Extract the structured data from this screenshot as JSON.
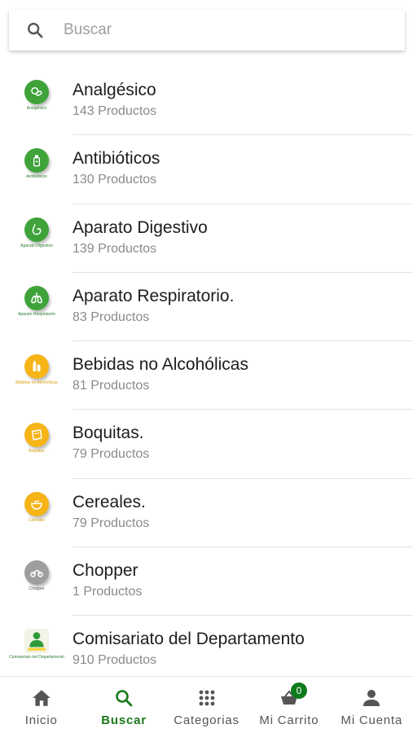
{
  "search": {
    "placeholder": "Buscar"
  },
  "categories": [
    {
      "name": "Analgésico",
      "count": "143 Productos",
      "icon": "pills-icon",
      "thumb_text": "Analgésico",
      "color": "#3fa33a"
    },
    {
      "name": "Antibióticos",
      "count": "130 Productos",
      "icon": "bottle-icon",
      "thumb_text": "Antibióticos",
      "color": "#3fa33a"
    },
    {
      "name": "Aparato Digestivo",
      "count": "139 Productos",
      "icon": "stomach-icon",
      "thumb_text": "Aparato Digestivo",
      "color": "#3fa33a"
    },
    {
      "name": "Aparato Respiratorio.",
      "count": "83 Productos",
      "icon": "lungs-icon",
      "thumb_text": "Aparato Respiratorio",
      "color": "#3fa33a"
    },
    {
      "name": "Bebidas no Alcohólicas",
      "count": "81 Productos",
      "icon": "bottles-icon",
      "thumb_text": "Bebidas no Alcohólicas",
      "color": "#f6b417"
    },
    {
      "name": "Boquitas.",
      "count": "79 Productos",
      "icon": "snack-icon",
      "thumb_text": "Boquitas",
      "color": "#f6b417"
    },
    {
      "name": "Cereales.",
      "count": "79 Productos",
      "icon": "cereal-bowl-icon",
      "thumb_text": "Cereales",
      "color": "#f6b417"
    },
    {
      "name": "Chopper",
      "count": "1 Productos",
      "icon": "motorcycle-icon",
      "thumb_text": "Chopper",
      "color": "#9e9e9e"
    },
    {
      "name": "Comisariato del Departamento",
      "count": "910 Productos",
      "icon": "person-icon",
      "thumb_text": "Comisariato del Departamento",
      "color": "#2f9a3a"
    }
  ],
  "nav": {
    "inicio": "Inicio",
    "buscar": "Buscar",
    "categorias": "Categorias",
    "carrito": "Mi Carrito",
    "cuenta": "Mi Cuenta",
    "cart_count": "0",
    "accent": "#1b7a1b"
  }
}
